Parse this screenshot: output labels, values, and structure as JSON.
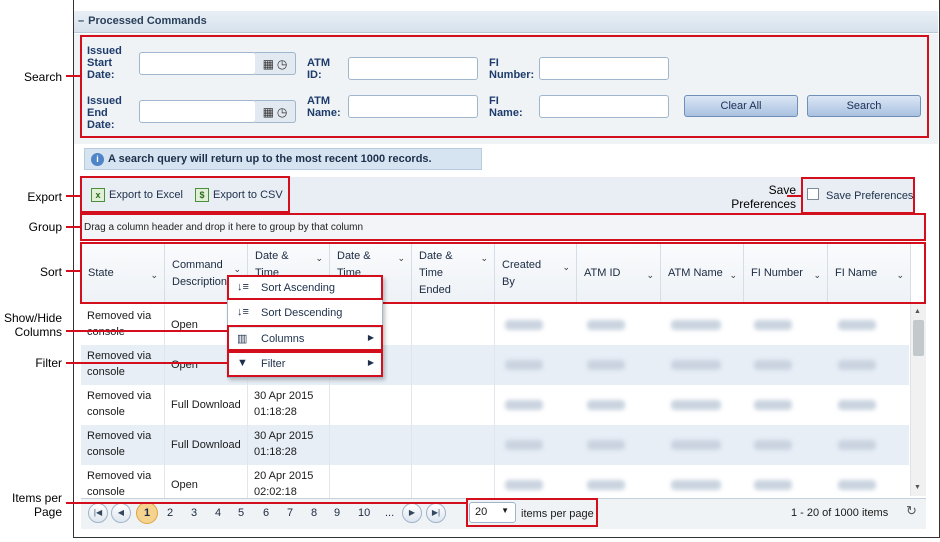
{
  "panel": {
    "title": "Processed Commands",
    "collapse": "–"
  },
  "search": {
    "issued_start_date": "Issued\nStart\nDate:",
    "issued_end_date": "Issued\nEnd\nDate:",
    "atm_id": "ATM\nID:",
    "atm_name": "ATM\nName:",
    "fi_number": "FI\nNumber:",
    "fi_name": "FI\nName:",
    "clear_all": "Clear All",
    "search_btn": "Search"
  },
  "info": "A search query will return up to the most recent 1000 records.",
  "toolbar": {
    "export_excel": "Export to Excel",
    "export_csv": "Export to CSV",
    "save_prefs": "Save Preferences"
  },
  "group_hint": "Drag a column header and drop it here to group by that column",
  "columns": [
    "State",
    "Command Description",
    "Date & Time",
    "Date & Time",
    "Date & Time Ended",
    "Created By",
    "ATM ID",
    "ATM Name",
    "FI Number",
    "FI Name"
  ],
  "rows": [
    {
      "state": "Removed via console",
      "command": "Open",
      "date": ""
    },
    {
      "state": "Removed via console",
      "command": "Open",
      "date": ""
    },
    {
      "state": "Removed via console",
      "command": "Full Download",
      "date": "30 Apr 2015 01:18:28"
    },
    {
      "state": "Removed via console",
      "command": "Full Download",
      "date": "30 Apr 2015 01:18:28"
    },
    {
      "state": "Removed via console",
      "command": "Open",
      "date": "20 Apr 2015 02:02:18"
    }
  ],
  "menu": {
    "sort_asc": "Sort Ascending",
    "sort_desc": "Sort Descending",
    "columns": "Columns",
    "filter": "Filter"
  },
  "pager": {
    "pages": [
      "1",
      "2",
      "3",
      "4",
      "5",
      "6",
      "7",
      "8",
      "9",
      "10",
      "..."
    ],
    "current": "1",
    "page_size": "20",
    "items_label": "items per page",
    "summary": "1 - 20 of 1000 items"
  },
  "callouts": {
    "search": "Search",
    "export": "Export",
    "save_prefs": "Save\nPreferences",
    "group": "Group",
    "sort": "Sort",
    "show_hide": "Show/Hide\nColumns",
    "filter": "Filter",
    "items_per_page": "Items per\nPage"
  }
}
